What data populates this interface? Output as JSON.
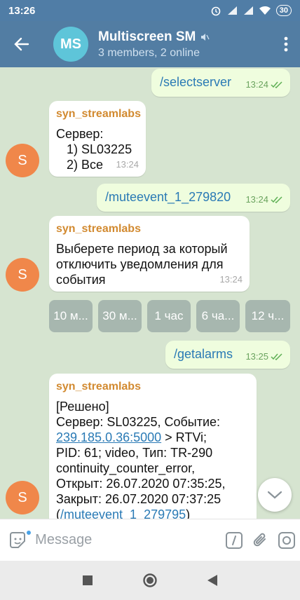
{
  "status": {
    "time": "13:26",
    "battery": "30"
  },
  "header": {
    "avatar": "MS",
    "title": "Multiscreen SM",
    "subtitle": "3 members, 2 online"
  },
  "messages": [
    {
      "dir": "out",
      "text": "/selectserver",
      "time": "13:24"
    },
    {
      "dir": "in",
      "sender": "syn_streamlabs",
      "lines": [
        "Сервер:",
        "   1) SL03225",
        "   2) Все"
      ],
      "time": "13:24"
    },
    {
      "dir": "out",
      "text": "/muteevent_1_279820",
      "time": "13:24"
    },
    {
      "dir": "in",
      "sender": "syn_streamlabs",
      "lines": [
        "Выберете период за который",
        "отключить уведомления для",
        "события"
      ],
      "time": "13:24"
    },
    {
      "dir": "out",
      "text": "/getalarms",
      "time": "13:25"
    },
    {
      "dir": "in",
      "sender": "syn_streamlabs",
      "line1": "[Решено]",
      "line2": "Сервер: SL03225, Событие:",
      "link": "239.185.0.36:5000",
      "line3_rest": "> RTVi;",
      "line4": "PID: 61; video, Тип: TR-290",
      "line5": "continuity_counter_error,",
      "line6": "Открыт: 26.07.2020 07:35:25,",
      "line7": "Закрыт: 26.07.2020 07:37:25",
      "line8_open": "(",
      "line8_link": "/muteevent_1_279795",
      "line8_close": ")"
    }
  ],
  "user_avatar": "S",
  "keyboard_buttons": [
    "10 м...",
    "30 м...",
    "1 час",
    "6 ча...",
    "12 ч..."
  ],
  "input": {
    "placeholder": "Message"
  },
  "icons": [
    "back-arrow-icon",
    "mute-icon",
    "more-vert-icon",
    "double-check-icon",
    "chevron-down-icon",
    "sticker-icon",
    "slash-command-icon",
    "paperclip-icon",
    "camera-icon",
    "nav-square-icon",
    "nav-circle-icon",
    "nav-back-icon"
  ],
  "colors": {
    "header": "#527da3",
    "status": "#507da6",
    "chat_bg": "#d6e4d0",
    "outgoing": "#effdde",
    "incoming": "#ffffff",
    "link": "#2a7ab5",
    "sender": "#d28a30",
    "avatar": "#f0874a"
  }
}
